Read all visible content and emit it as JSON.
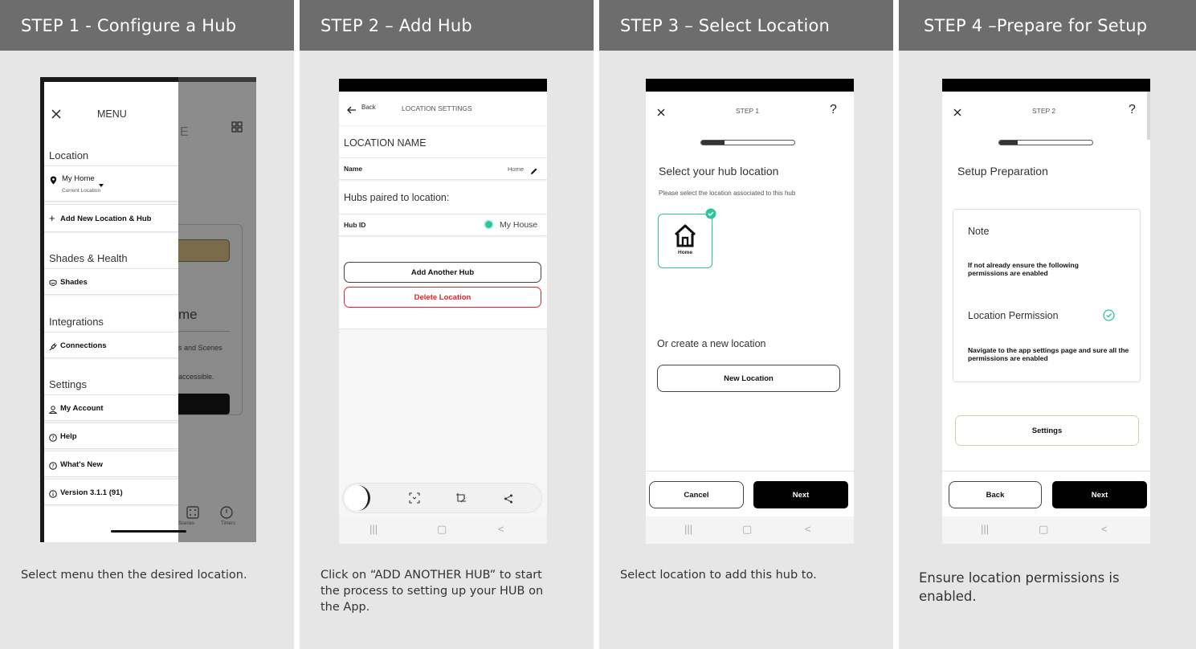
{
  "steps": [
    {
      "title": "STEP 1 - Configure a Hub",
      "caption": "Select menu then the desired location.",
      "phone": {
        "menu_title": "MENU",
        "location_heading": "Location",
        "current_location_name": "My Home",
        "current_location_sub": "Current Location",
        "add_location": "Add New Location & Hub",
        "shades_heading": "Shades & Health",
        "shades_item": "Shades",
        "integrations_heading": "Integrations",
        "connections_item": "Connections",
        "settings_heading": "Settings",
        "my_account": "My Account",
        "help": "Help",
        "whats_new": "What's New",
        "version": "Version 3.1.1 (91)",
        "bg_letter": "E",
        "bg_title_fragment": "me",
        "bg_text_1": "s and Scenes",
        "bg_text_2": "accessible.",
        "bg_tab_scenes": "Scenes",
        "bg_tab_timers": "Timers"
      }
    },
    {
      "title": "STEP 2 – Add Hub",
      "caption": "Click on “ADD ANOTHER HUB” to start the process to setting up your HUB on the App.",
      "phone": {
        "back_label": "Back",
        "header_title": "LOCATION SETTINGS",
        "location_name_heading": "LOCATION NAME",
        "name_label": "Name",
        "name_value": "Home",
        "hubs_heading": "Hubs paired to location:",
        "hub_id_label": "Hub ID",
        "hub_name": "My House",
        "add_hub_button": "Add Another Hub",
        "delete_button": "Delete Location"
      }
    },
    {
      "title": "STEP 3 – Select Location",
      "caption": "Select location to add this hub to.",
      "phone": {
        "step_label": "STEP 1",
        "help_glyph": "?",
        "heading": "Select your hub location",
        "subtitle": "Please select the location associated to this hub",
        "tile_label": "Home",
        "create_heading": "Or create a new location",
        "new_location_button": "New Location",
        "cancel_button": "Cancel",
        "next_button": "Next",
        "progress": 0.25
      }
    },
    {
      "title": "STEP 4 –Prepare for Setup",
      "caption": "Ensure location permissions is enabled.",
      "phone": {
        "step_label": "STEP 2",
        "help_glyph": "?",
        "heading": "Setup Preparation",
        "note_heading": "Note",
        "note_text": "If not already ensure the following permissions are enabled",
        "permission_label": "Location Permission",
        "navigate_text": "Navigate to the app settings page and sure all the permissions are enabled",
        "settings_button": "Settings",
        "back_button": "Back",
        "next_button": "Next",
        "progress": 0.2
      }
    }
  ],
  "colors": {
    "header_bg": "#6d6d6d",
    "panel_bg": "#e6e6e6",
    "accent_teal": "#2ec4a1",
    "delete_red": "#e0242f",
    "gold_button": "#b9a57a"
  }
}
